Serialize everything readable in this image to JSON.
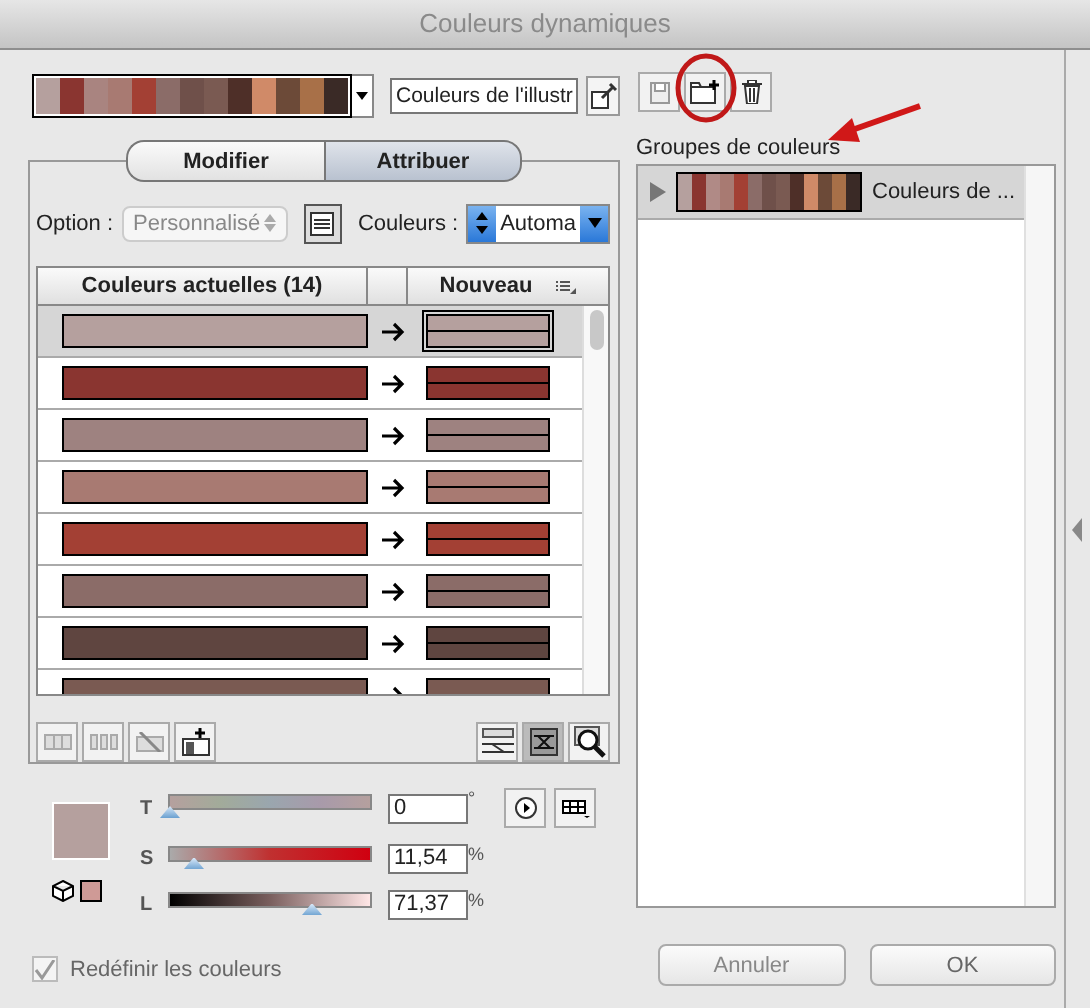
{
  "window": {
    "title": "Couleurs dynamiques"
  },
  "color_strip": {
    "colors": [
      {
        "color": "#b5a09e"
      },
      {
        "color": "#8a3530"
      },
      {
        "color": "#a98480"
      },
      {
        "color": "#a87a72"
      },
      {
        "color": "#a34034"
      },
      {
        "color": "#8b6c68"
      },
      {
        "color": "#6f504a"
      },
      {
        "color": "#7a5a52"
      },
      {
        "color": "#4e2f28"
      },
      {
        "color": "#d08a68"
      },
      {
        "color": "#6c4a38"
      },
      {
        "color": "#a87048"
      },
      {
        "color": "#3a2a26"
      }
    ]
  },
  "name_field": {
    "value": "Couleurs de l'illustr"
  },
  "tabs": [
    {
      "label": "Modifier",
      "selected": false
    },
    {
      "label": "Attribuer",
      "selected": true
    }
  ],
  "option": {
    "label": "Option :",
    "value": "Personnalisé",
    "disabled": true
  },
  "couleurs": {
    "label": "Couleurs :",
    "value": "Automa"
  },
  "table": {
    "columns": [
      "Couleurs actuelles (14)",
      "Nouveau"
    ],
    "rows": [
      {
        "color": "#b5a09e",
        "selected": true
      },
      {
        "color": "#8a3530",
        "selected": false
      },
      {
        "color": "#9e8280",
        "selected": false
      },
      {
        "color": "#a87a72",
        "selected": false
      },
      {
        "color": "#a34034",
        "selected": false
      },
      {
        "color": "#8b6c68",
        "selected": false
      },
      {
        "color": "#5f4540",
        "selected": false
      },
      {
        "color": "#7a5a52",
        "selected": false
      }
    ]
  },
  "current_color": {
    "color": "#b5a09e"
  },
  "sliders": [
    {
      "label": "T",
      "kind": "hue",
      "level": 0,
      "value": "0",
      "unit": "°"
    },
    {
      "label": "S",
      "kind": "saturation",
      "level": 0.12,
      "value": "11,54",
      "unit": "%"
    },
    {
      "label": "L",
      "kind": "lightness",
      "level": 0.71,
      "value": "71,37",
      "unit": "%"
    }
  ],
  "recolor_checkbox": {
    "label": "Redéfinir les couleurs",
    "checked": true,
    "disabled": true
  },
  "groups": {
    "label": "Groupes de couleurs",
    "items": [
      {
        "name": "Couleurs de ...",
        "selected": true,
        "colors": [
          {
            "color": "#b5a09e"
          },
          {
            "color": "#8a3530"
          },
          {
            "color": "#b08a86"
          },
          {
            "color": "#a87a72"
          },
          {
            "color": "#a34034"
          },
          {
            "color": "#8b6c68"
          },
          {
            "color": "#6f504a"
          },
          {
            "color": "#7a5a52"
          },
          {
            "color": "#4e2f28"
          },
          {
            "color": "#d08a68"
          },
          {
            "color": "#6c4a38"
          },
          {
            "color": "#a87048"
          },
          {
            "color": "#3a2a26"
          }
        ]
      }
    ]
  },
  "buttons": [
    {
      "label": "Annuler",
      "kind": "cancel"
    },
    {
      "label": "OK",
      "kind": "default"
    }
  ]
}
